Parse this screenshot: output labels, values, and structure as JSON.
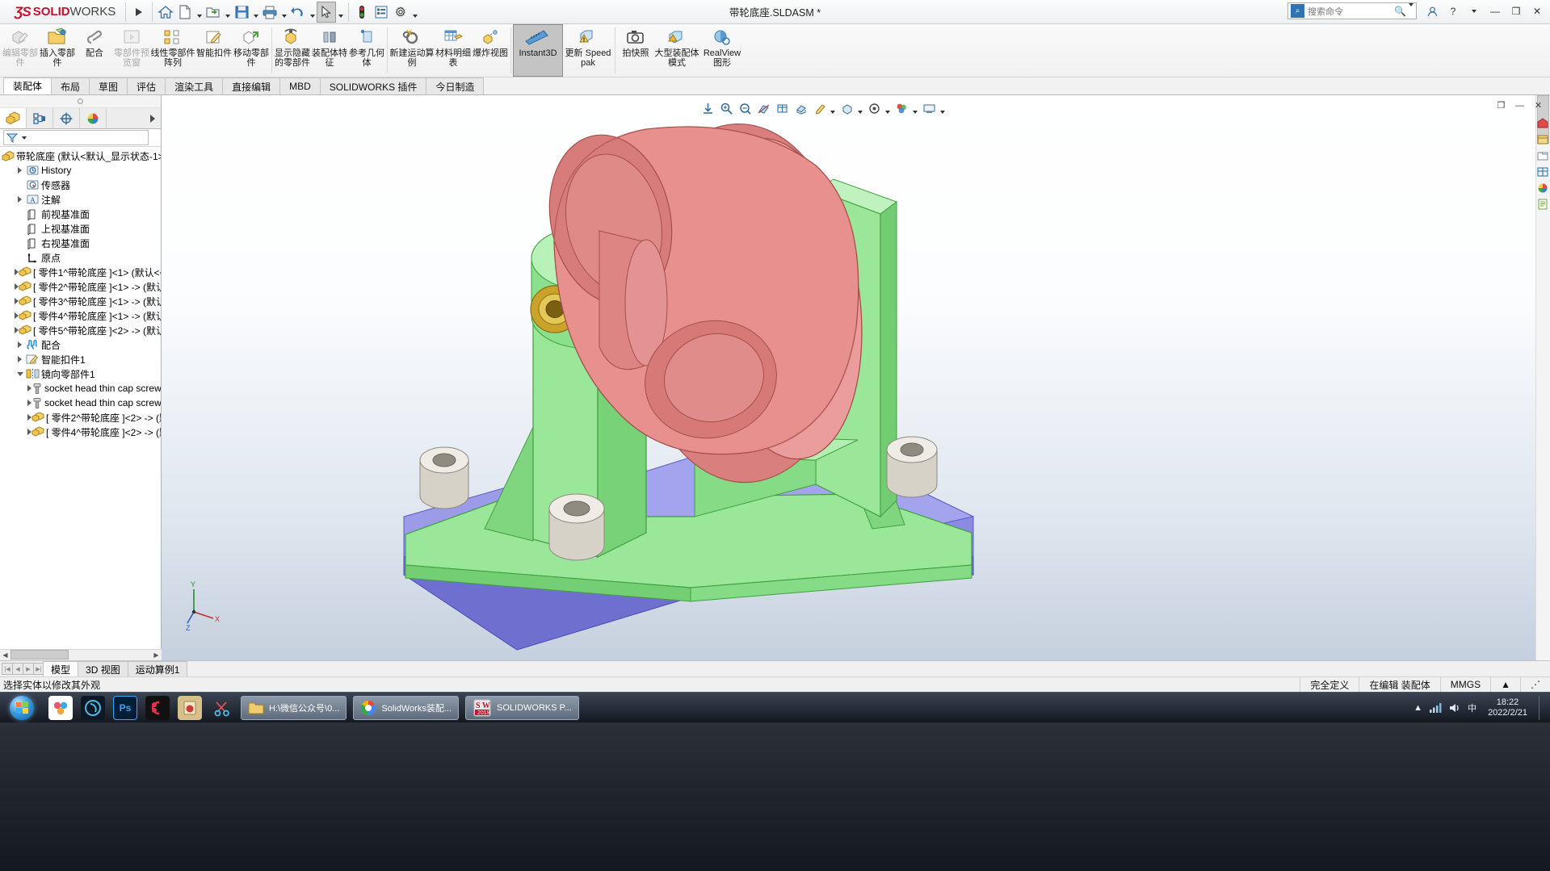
{
  "app": {
    "brand_ds": "2S",
    "brand_solid": "SOLID",
    "brand_works": "WORKS",
    "document_title": "带轮底座.SLDASM *"
  },
  "titlebar": {
    "quick_access": [
      {
        "name": "home-icon",
        "label": "主页"
      },
      {
        "name": "new-document-icon",
        "label": "新建"
      },
      {
        "name": "open-folder-icon",
        "label": "打开"
      },
      {
        "name": "save-icon",
        "label": "保存"
      },
      {
        "name": "print-icon",
        "label": "打印"
      },
      {
        "name": "undo-icon",
        "label": "撤销"
      },
      {
        "name": "select-arrow-icon",
        "label": "选择"
      },
      {
        "name": "rebuild-icon",
        "label": "重建模型"
      },
      {
        "name": "options-list-icon",
        "label": "选项列表"
      },
      {
        "name": "gear-icon",
        "label": "选项"
      }
    ],
    "search_placeholder": "搜索命令",
    "help_label": "?",
    "window_minimize": "—",
    "window_restore": "❐",
    "window_close": "✕"
  },
  "ribbon": {
    "groups": [
      {
        "items": [
          {
            "label": "编辑零部件",
            "icon": "edit-component-icon",
            "state": "disabled"
          },
          {
            "label": "插入零部件",
            "icon": "insert-component-icon",
            "state": "normal"
          },
          {
            "label": "配合",
            "icon": "mate-icon",
            "state": "normal"
          },
          {
            "label": "零部件预览窗",
            "icon": "component-preview-icon",
            "state": "disabled"
          },
          {
            "label": "线性零部件阵列",
            "icon": "linear-component-pattern-icon",
            "state": "normal"
          },
          {
            "label": "智能扣件",
            "icon": "smart-fastener-icon",
            "state": "normal"
          },
          {
            "label": "移动零部件",
            "icon": "move-component-icon",
            "state": "normal"
          },
          {
            "label": "显示隐藏的零部件",
            "icon": "show-hidden-components-icon",
            "state": "normal"
          }
        ]
      },
      {
        "items": [
          {
            "label": "装配体特征",
            "icon": "assembly-feature-icon",
            "state": "normal"
          },
          {
            "label": "参考几何体",
            "icon": "reference-geometry-icon",
            "state": "normal"
          },
          {
            "label": "新建运动算例",
            "icon": "new-motion-study-icon",
            "state": "normal"
          },
          {
            "label": "材料明细表",
            "icon": "bill-of-materials-icon",
            "state": "normal"
          },
          {
            "label": "爆炸视图",
            "icon": "exploded-view-icon",
            "state": "normal"
          },
          {
            "label": "Instant3D",
            "icon": "instant3d-icon",
            "state": "active"
          },
          {
            "label": "更新 Speedpak",
            "icon": "update-speedpak-icon",
            "state": "normal"
          },
          {
            "label": "拍快照",
            "icon": "snapshot-icon",
            "state": "normal"
          },
          {
            "label": "大型装配体模式",
            "icon": "large-assembly-mode-icon",
            "state": "normal"
          },
          {
            "label": "RealView 图形",
            "icon": "realview-graphics-icon",
            "state": "normal"
          }
        ]
      }
    ]
  },
  "tabs": [
    {
      "label": "装配体",
      "active": true
    },
    {
      "label": "布局",
      "active": false
    },
    {
      "label": "草图",
      "active": false
    },
    {
      "label": "评估",
      "active": false
    },
    {
      "label": "渲染工具",
      "active": false
    },
    {
      "label": "直接编辑",
      "active": false
    },
    {
      "label": "MBD",
      "active": false
    },
    {
      "label": "SOLIDWORKS 插件",
      "active": false
    },
    {
      "label": "今日制造",
      "active": false
    }
  ],
  "view_toolbar": [
    {
      "name": "zoom-to-fit-icon"
    },
    {
      "name": "zoom-to-area-icon"
    },
    {
      "name": "previous-view-icon"
    },
    {
      "name": "section-view-icon"
    },
    {
      "name": "view-orientation-icon"
    },
    {
      "name": "display-style-icon"
    },
    {
      "name": "hide-show-items-icon"
    },
    {
      "name": "edit-appearance-icon"
    },
    {
      "name": "apply-scene-icon"
    },
    {
      "name": "view-settings-icon"
    }
  ],
  "left_panel": {
    "tabs": [
      {
        "name": "feature-manager-tab",
        "label": "FeatureManager 设计树",
        "active": true
      },
      {
        "name": "property-manager-tab",
        "label": "PropertyManager",
        "active": false
      },
      {
        "name": "configuration-manager-tab",
        "label": "ConfigurationManager",
        "active": false
      },
      {
        "name": "display-manager-tab",
        "label": "DisplayManager",
        "active": false
      }
    ],
    "filter_placeholder": "",
    "tree": [
      {
        "label": "带轮底座  (默认<默认_显示状态-1>)",
        "indent": 0,
        "icon": "assembly-icon",
        "toggle": "none"
      },
      {
        "label": "History",
        "indent": 1,
        "icon": "history-icon",
        "toggle": "closed"
      },
      {
        "label": "传感器",
        "indent": 1,
        "icon": "sensor-icon",
        "toggle": "none"
      },
      {
        "label": "注解",
        "indent": 1,
        "icon": "annotations-icon",
        "toggle": "closed"
      },
      {
        "label": "前视基准面",
        "indent": 1,
        "icon": "plane-icon",
        "toggle": "none"
      },
      {
        "label": "上视基准面",
        "indent": 1,
        "icon": "plane-icon",
        "toggle": "none"
      },
      {
        "label": "右视基准面",
        "indent": 1,
        "icon": "plane-icon",
        "toggle": "none"
      },
      {
        "label": "原点",
        "indent": 1,
        "icon": "origin-icon",
        "toggle": "none"
      },
      {
        "label": "[ 零件1^带轮底座 ]<1> (默认<<默",
        "indent": 1,
        "icon": "part-icon",
        "toggle": "closed"
      },
      {
        "label": "[ 零件2^带轮底座 ]<1> -> (默认<",
        "indent": 1,
        "icon": "part-icon",
        "toggle": "closed"
      },
      {
        "label": "[ 零件3^带轮底座 ]<1> -> (默认<",
        "indent": 1,
        "icon": "part-icon",
        "toggle": "closed"
      },
      {
        "label": "[ 零件4^带轮底座 ]<1> -> (默认<",
        "indent": 1,
        "icon": "part-icon",
        "toggle": "closed"
      },
      {
        "label": "[ 零件5^带轮底座 ]<2> -> (默认<",
        "indent": 1,
        "icon": "part-icon",
        "toggle": "closed"
      },
      {
        "label": "配合",
        "indent": 1,
        "icon": "mates-folder-icon",
        "toggle": "closed"
      },
      {
        "label": "智能扣件1",
        "indent": 1,
        "icon": "smart-fastener-folder-icon",
        "toggle": "closed"
      },
      {
        "label": "镜向零部件1",
        "indent": 1,
        "icon": "mirror-components-icon",
        "toggle": "open"
      },
      {
        "label": "socket head thin cap screw_c",
        "indent": 2,
        "icon": "screw-icon",
        "toggle": "closed"
      },
      {
        "label": "socket head thin cap screw_c",
        "indent": 2,
        "icon": "screw-icon",
        "toggle": "closed"
      },
      {
        "label": "[ 零件2^带轮底座 ]<2> -> (默",
        "indent": 2,
        "icon": "part-icon",
        "toggle": "closed"
      },
      {
        "label": "[ 零件4^带轮底座 ]<2> -> (默",
        "indent": 2,
        "icon": "part-icon",
        "toggle": "closed"
      }
    ]
  },
  "model": {
    "colors": {
      "pulley_red": "#e8908e",
      "pulley_red_dark": "#cf7472",
      "base_green": "#9ae79a",
      "base_green_dark": "#6cc66c",
      "plate_purple": "#9b9be8",
      "plate_purple_dark": "#7d7ddc",
      "bushing_cyan": "#86d6ec",
      "screw_white": "#e9e6df",
      "bearing_gold": "#c8a020"
    },
    "triad_axes": [
      "Y",
      "X",
      "Z"
    ]
  },
  "bottom_tabs": [
    {
      "label": "模型",
      "active": true
    },
    {
      "label": "3D 视图",
      "active": false
    },
    {
      "label": "运动算例1",
      "active": false
    }
  ],
  "statusbar": {
    "message": "选择实体以修改其外观",
    "state": "完全定义",
    "edit_mode": "在编辑 装配体",
    "units": "MMGS",
    "units_caret": "▲"
  },
  "taskbar": {
    "quick_icons": [
      {
        "name": "start-orb-icon"
      },
      {
        "name": "browser-icon"
      },
      {
        "name": "media-player-icon"
      },
      {
        "name": "photoshop-icon",
        "label": "Ps"
      },
      {
        "name": "recorder-icon"
      },
      {
        "name": "pdf-tool-icon"
      },
      {
        "name": "snipping-tool-icon"
      }
    ],
    "items": [
      {
        "name": "explorer-window-item",
        "label": "H:\\微信公众号\\0...",
        "icon": "folder-icon"
      },
      {
        "name": "solidworks-assembly-item",
        "label": "SolidWorks装配...",
        "icon": "chrome-icon"
      },
      {
        "name": "solidworks-premium-item",
        "label": "SOLIDWORKS P...",
        "icon": "solidworks-2019-icon"
      }
    ],
    "tray": {
      "time": "18:22",
      "date": "2022/2/21"
    }
  }
}
